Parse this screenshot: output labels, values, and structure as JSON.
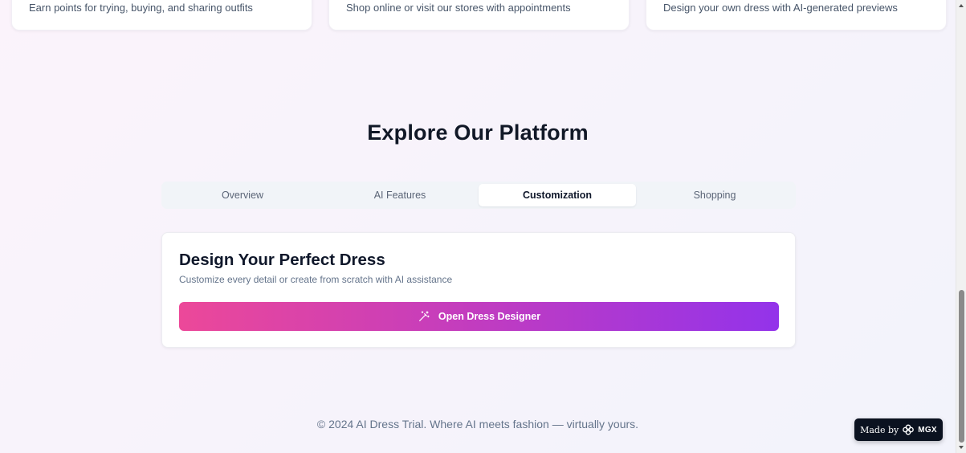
{
  "features": [
    {
      "description": "Earn points for trying, buying, and sharing outfits"
    },
    {
      "description": "Shop online or visit our stores with appointments"
    },
    {
      "description": "Design your own dress with AI-generated previews"
    }
  ],
  "explore": {
    "title": "Explore Our Platform",
    "tabs": [
      {
        "label": "Overview",
        "active": false
      },
      {
        "label": "AI Features",
        "active": false
      },
      {
        "label": "Customization",
        "active": true
      },
      {
        "label": "Shopping",
        "active": false
      }
    ]
  },
  "designer": {
    "title": "Design Your Perfect Dress",
    "subtitle": "Customize every detail or create from scratch with AI assistance",
    "button_label": "Open Dress Designer",
    "button_icon": "magic-wand-icon"
  },
  "footer": {
    "text": "© 2024 AI Dress Trial. Where AI meets fashion — virtually yours."
  },
  "badge": {
    "made_by": "Made by",
    "brand": "MGX"
  },
  "colors": {
    "gradient_start": "#ec4899",
    "gradient_end": "#9333ea",
    "badge_bg": "#0b1220"
  }
}
